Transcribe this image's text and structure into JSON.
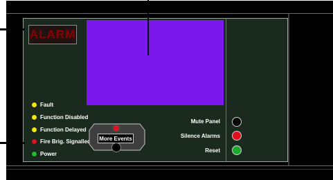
{
  "alarm_label": "ALARM",
  "colors": {
    "display": "#7a18ee",
    "alarm_text": "#8b0000",
    "panel_bg": "#1a2a1f"
  },
  "leds": [
    {
      "label": "Fault",
      "color": "#f3e713"
    },
    {
      "label": "Function Disabled",
      "color": "#f3e713"
    },
    {
      "label": "Function Delayed",
      "color": "#f3e713"
    },
    {
      "label": "Fire Brig. Signalled",
      "color": "#e0101d"
    },
    {
      "label": "Power",
      "color": "#1fbf2a"
    }
  ],
  "more_events": {
    "label": "More Events"
  },
  "controls": [
    {
      "label": "Mute Panel",
      "color": "#000000"
    },
    {
      "label": "Silence Alarms",
      "color": "#e0101d"
    },
    {
      "label": "Reset",
      "color": "#1fa82a"
    }
  ]
}
